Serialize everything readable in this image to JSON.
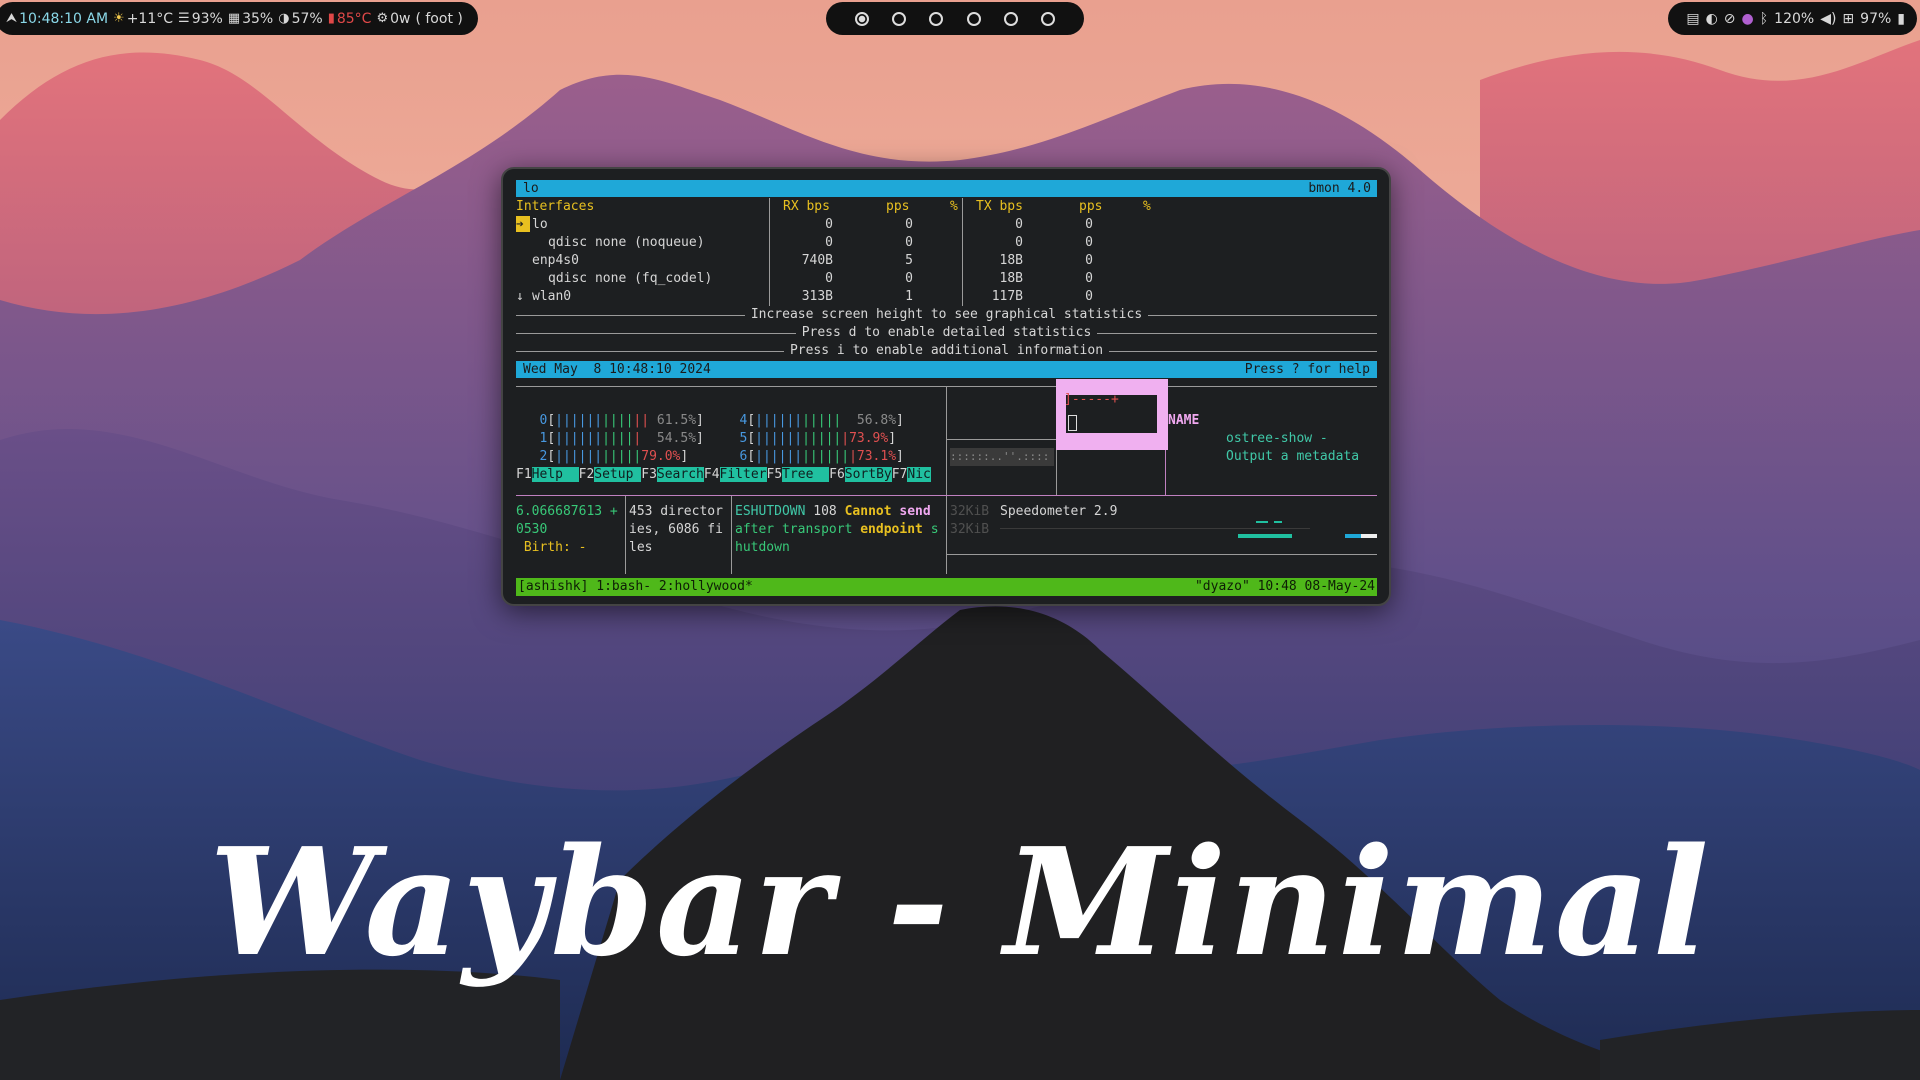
{
  "colors": {
    "bar_bg": "#111111",
    "term_bg": "#1d1f21",
    "header_cyan": "#1fa8d8",
    "tmux_green": "#4fb81a",
    "highlight_pink": "#f0b0f0"
  },
  "waybar": {
    "left": {
      "launcher_icon": "arch-icon",
      "clock": "10:48:10 AM",
      "weather_icon": "sun-icon",
      "weather": "+11°C",
      "disk_icon": "database-icon",
      "disk": "93%",
      "memory_icon": "memory-icon",
      "memory": "35%",
      "cpu_icon": "cpu-icon",
      "cpu": "57%",
      "temp_icon": "thermometer-icon",
      "temp": "85°C",
      "power_icon": "gear-icon",
      "power": "0w",
      "window": "( foot )"
    },
    "workspaces": {
      "count": 6,
      "active_index": 0
    },
    "right": {
      "clipboard_icon": "clipboard-icon",
      "theme_icon": "contrast-icon",
      "idle_icon": "eye-off-icon",
      "droplet_icon": "droplet-icon",
      "bluetooth_icon": "bluetooth-icon",
      "volume": "120%",
      "volume_icon": "speaker-icon",
      "network_icon": "network-icon",
      "battery": "97%",
      "battery_icon": "battery-icon"
    }
  },
  "bmon": {
    "header_left": "lo",
    "header_right": "bmon 4.0",
    "columns": {
      "interfaces": "Interfaces",
      "rx_bps": "RX bps",
      "rx_pps": "pps",
      "rx_pct": "%",
      "tx_bps": "TX bps",
      "tx_pps": "pps",
      "tx_pct": "%"
    },
    "rows": [
      {
        "name": "lo",
        "rx_bps": "0",
        "rx_pps": "0",
        "tx_bps": "0",
        "tx_pps": "0"
      },
      {
        "name": "qdisc none (noqueue)",
        "rx_bps": "0",
        "rx_pps": "0",
        "tx_bps": "0",
        "tx_pps": "0"
      },
      {
        "name": "enp4s0",
        "rx_bps": "740B",
        "rx_pps": "5",
        "tx_bps": "18B",
        "tx_pps": "0"
      },
      {
        "name": "qdisc none (fq_codel)",
        "rx_bps": "0",
        "rx_pps": "0",
        "tx_bps": "18B",
        "tx_pps": "0"
      },
      {
        "name": "wlan0",
        "rx_bps": "313B",
        "rx_pps": "1",
        "tx_bps": "117B",
        "tx_pps": "0"
      }
    ],
    "msg1": "Increase screen height to see graphical statistics",
    "msg2": "Press d to enable detailed statistics",
    "msg3": "Press i to enable additional information",
    "status_left": "Wed May  8 10:48:10 2024",
    "status_right": "Press ? for help"
  },
  "htop": {
    "cpus": [
      {
        "label": "0",
        "pct": "61.5%"
      },
      {
        "label": "1",
        "pct": "54.5%"
      },
      {
        "label": "2",
        "pct": "79.0%"
      },
      {
        "label": "4",
        "pct": "56.8%"
      },
      {
        "label": "5",
        "pct": "73.9%"
      },
      {
        "label": "6",
        "pct": "73.1%"
      }
    ],
    "fkeys": [
      {
        "key": "F1",
        "label": "Help  "
      },
      {
        "key": "F2",
        "label": "Setup "
      },
      {
        "key": "F3",
        "label": "Search"
      },
      {
        "key": "F4",
        "label": "Filter"
      },
      {
        "key": "F5",
        "label": "Tree  "
      },
      {
        "key": "F6",
        "label": "SortBy"
      },
      {
        "key": "F7",
        "label": "Nic"
      }
    ]
  },
  "panes": {
    "name_header": "NAME",
    "man_line1": "ostree-show -",
    "man_line2": "Output a metadata",
    "ts_line1": "6.066687613 +",
    "ts_line2": "0530",
    "ts_line3": " Birth: -",
    "dir_line1": "453 director",
    "dir_line2": "ies, 6086 fi",
    "dir_line3": "les",
    "log_word1": "ESHUTDOWN",
    "log_word2": "108",
    "log_word3": "Cannot",
    "log_word4": "send",
    "log_word5": "after transport",
    "log_word6": "endpoint",
    "log_word7": "s",
    "log_word8": "hutdown",
    "mem1": "32KiB",
    "mem2": "32KiB",
    "speedometer": "Speedometer 2.9",
    "box_top": "]-----+"
  },
  "tmux": {
    "left": "[ashishk] 1:bash- 2:hollywood*",
    "right": "\"dyazo\" 10:48 08-May-24"
  },
  "title": "Waybar - Minimal"
}
